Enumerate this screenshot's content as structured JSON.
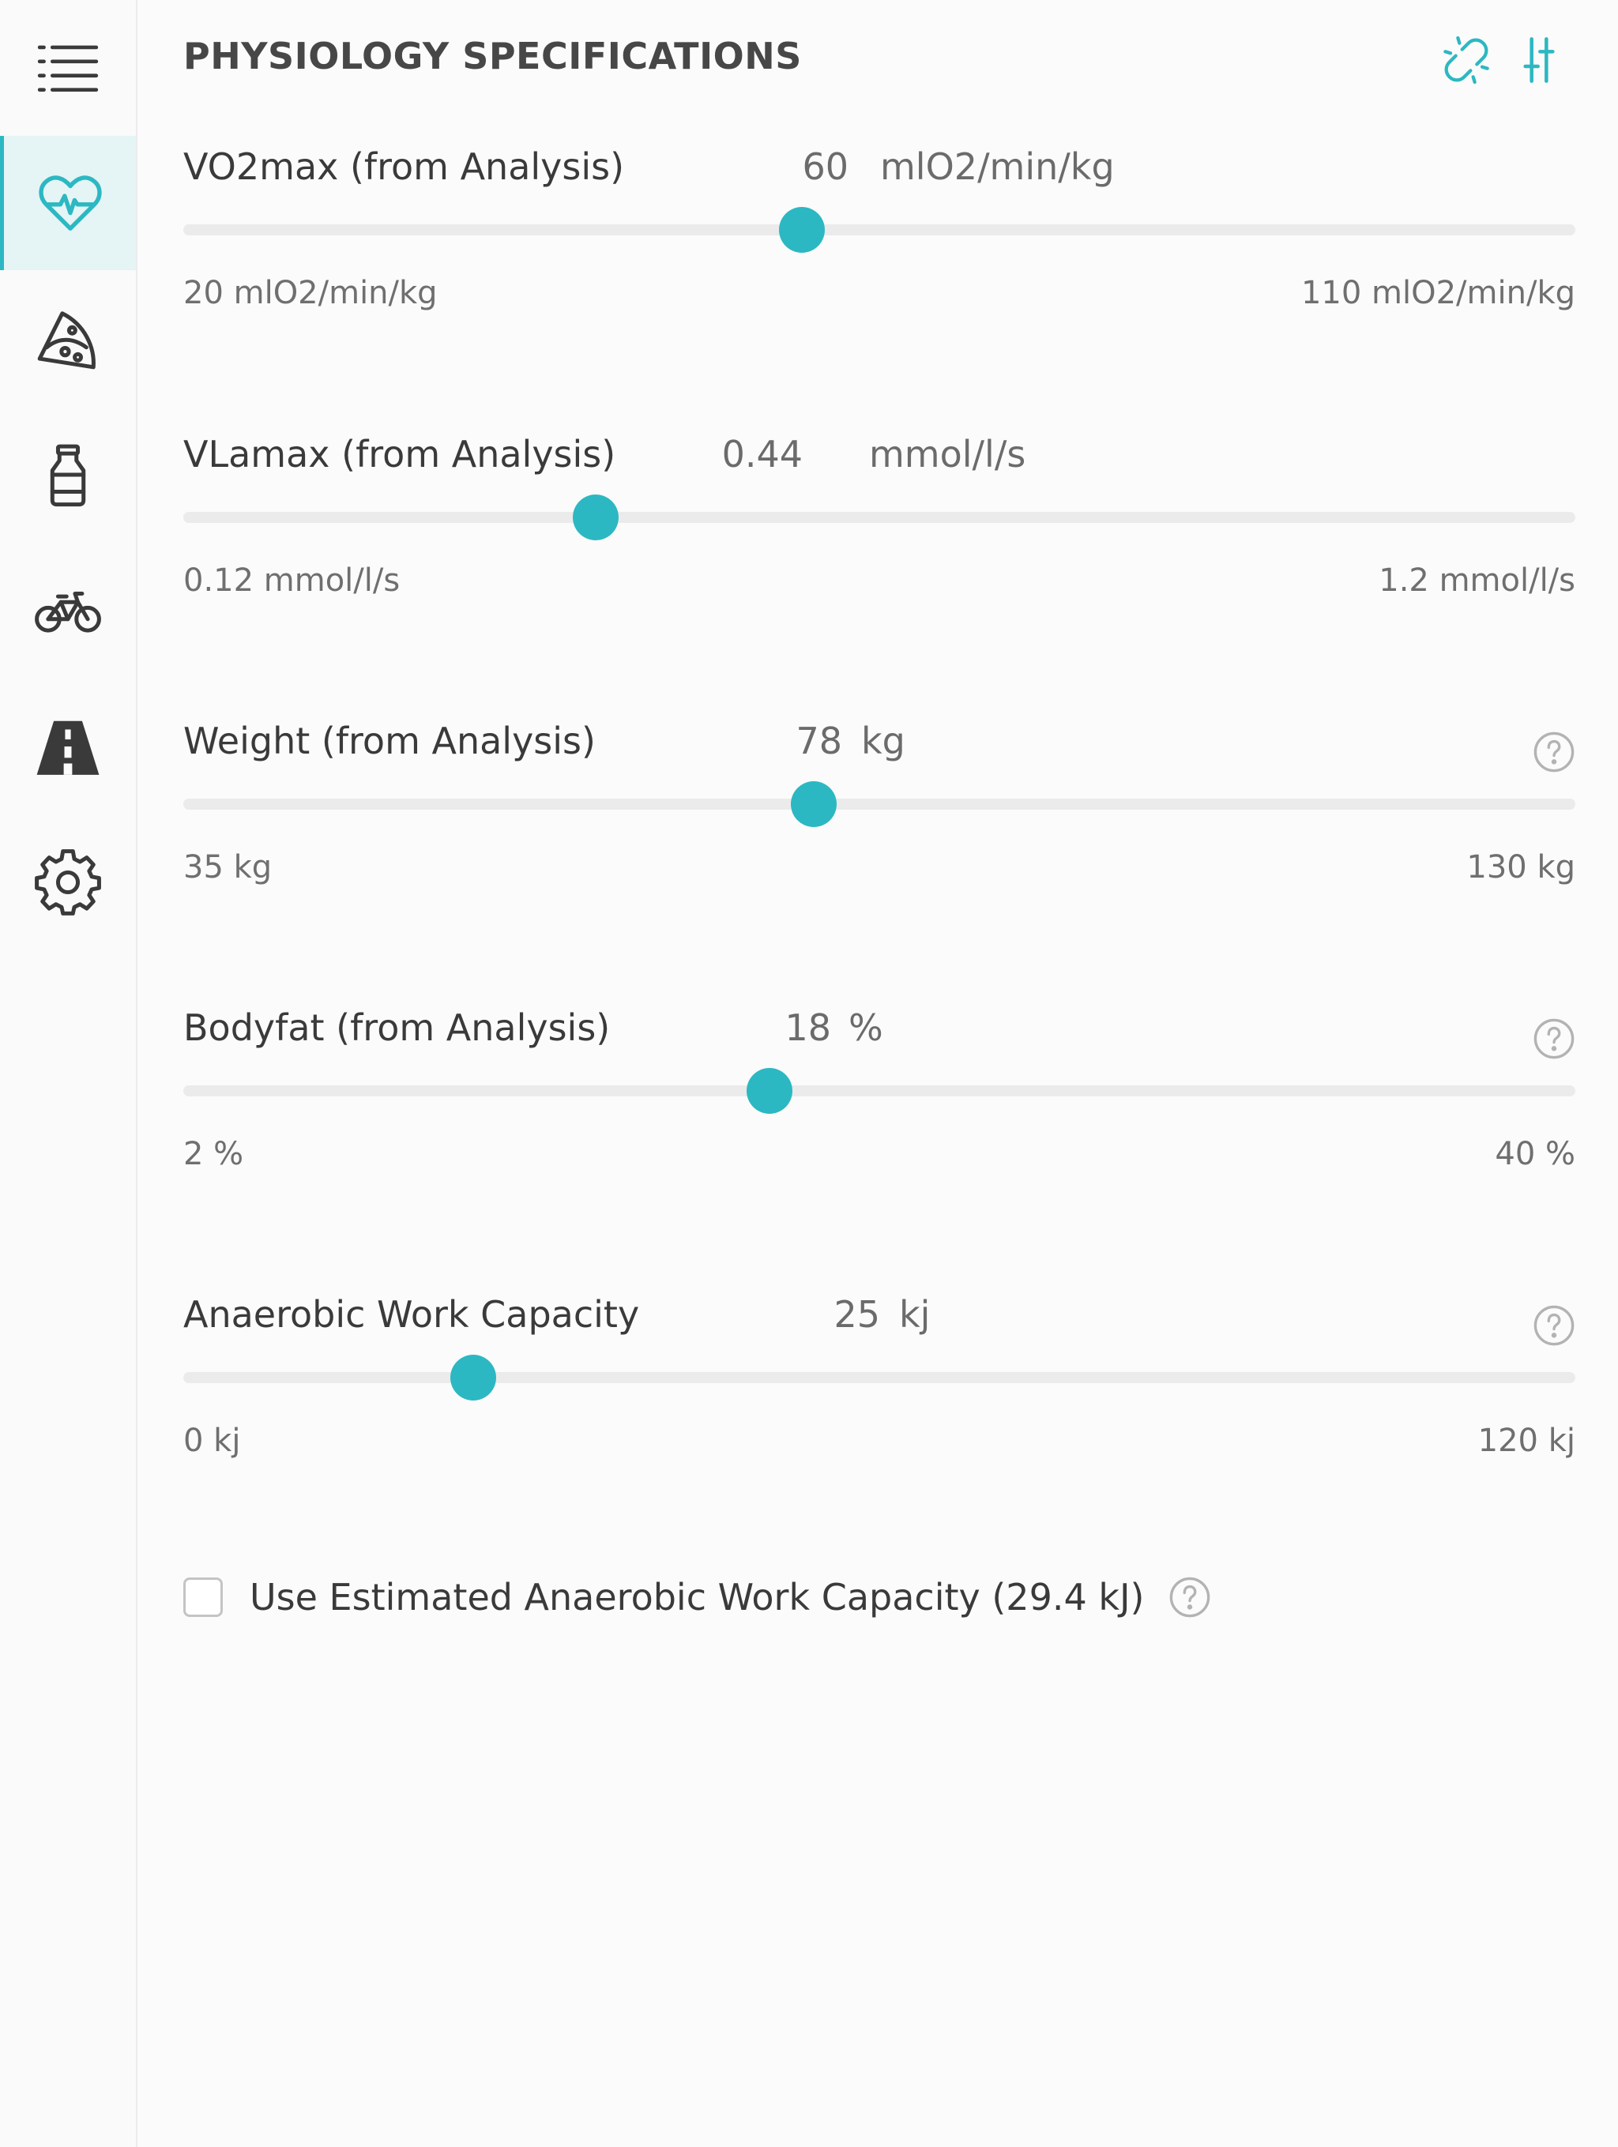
{
  "header": {
    "title": "PHYSIOLOGY SPECIFICATIONS",
    "icons": [
      "unlink-icon",
      "sliders-icon"
    ]
  },
  "sidebar": {
    "items": [
      {
        "icon": "menu-list-icon",
        "active": false
      },
      {
        "icon": "heart-pulse-icon",
        "active": true
      },
      {
        "icon": "pizza-slice-icon",
        "active": false
      },
      {
        "icon": "bottle-icon",
        "active": false
      },
      {
        "icon": "bicycle-icon",
        "active": false
      },
      {
        "icon": "road-icon",
        "active": false
      },
      {
        "icon": "gear-icon",
        "active": false
      }
    ]
  },
  "params": [
    {
      "label": "VO2max (from Analysis)",
      "value": "60",
      "unit": "mlO2/min/kg",
      "min_label": "20 mlO2/min/kg",
      "max_label": "110 mlO2/min/kg",
      "min": 20,
      "max": 110,
      "current": 60,
      "has_help": false
    },
    {
      "label": "VLamax (from Analysis)",
      "value": "0.44",
      "unit": "mmol/l/s",
      "min_label": "0.12 mmol/l/s",
      "max_label": "1.2 mmol/l/s",
      "min": 0.12,
      "max": 1.2,
      "current": 0.44,
      "has_help": false
    },
    {
      "label": "Weight (from Analysis)",
      "value": "78",
      "unit": "kg",
      "min_label": "35 kg",
      "max_label": "130 kg",
      "min": 35,
      "max": 130,
      "current": 78,
      "has_help": true
    },
    {
      "label": "Bodyfat (from Analysis)",
      "value": "18",
      "unit": "%",
      "min_label": "2 %",
      "max_label": "40 %",
      "min": 2,
      "max": 40,
      "current": 18,
      "has_help": true
    },
    {
      "label": "Anaerobic Work Capacity",
      "value": "25",
      "unit": "kj",
      "min_label": "0 kj",
      "max_label": "120 kj",
      "min": 0,
      "max": 120,
      "current": 25,
      "has_help": true
    }
  ],
  "estimate": {
    "label": "Use Estimated Anaerobic Work Capacity (29.4 kJ)",
    "checked": false
  },
  "colors": {
    "accent": "#2cb8c2",
    "active_bg": "#e5f4f5",
    "track": "#ebebeb"
  }
}
